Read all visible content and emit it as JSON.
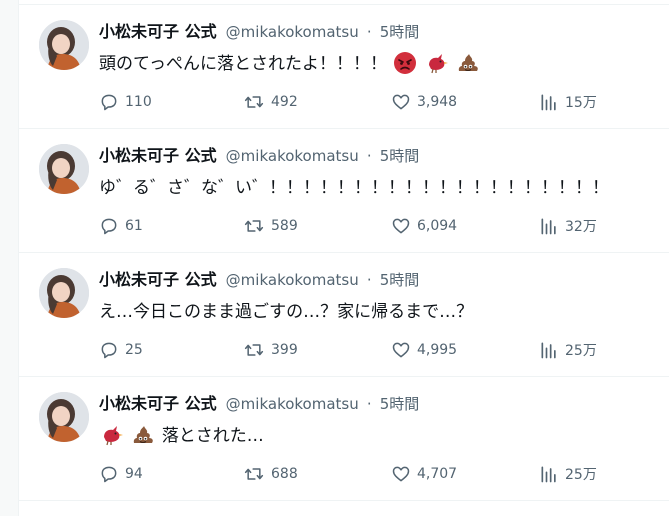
{
  "account": {
    "display_name": "小松未可子 公式",
    "handle": "@mikakokomatsu",
    "separator": "·"
  },
  "tweets": [
    {
      "time": "5時間",
      "text": "頭のてっぺんに落とされたよ！！！！",
      "emoji": [
        "angry-face",
        "red-bird",
        "pile-of-poo"
      ],
      "emoji_position": "after",
      "replies": "110",
      "retweets": "492",
      "likes": "3,948",
      "views": "15万"
    },
    {
      "time": "5時間",
      "text": "ゆ゛る゛さ゛な゛い゛！！！！！！！！！！！！！！！！！！！！",
      "emoji": [],
      "emoji_position": "none",
      "replies": "61",
      "retweets": "589",
      "likes": "6,094",
      "views": "32万"
    },
    {
      "time": "5時間",
      "text": "え…今日このまま過ごすの…？家に帰るまで…？",
      "emoji": [],
      "emoji_position": "none",
      "replies": "25",
      "retweets": "399",
      "likes": "4,995",
      "views": "25万"
    },
    {
      "time": "5時間",
      "text": "落とされた…",
      "emoji": [
        "red-bird",
        "pile-of-poo"
      ],
      "emoji_position": "before",
      "replies": "94",
      "retweets": "688",
      "likes": "4,707",
      "views": "25万"
    }
  ],
  "colors": {
    "text": "#0f1419",
    "secondary": "#536471",
    "divider": "#eff3f4",
    "avatar_coat": "#c1622f",
    "emoji_angry": "#d22f3c",
    "emoji_bird": "#c9283e",
    "emoji_poo": "#8a5a3c"
  }
}
